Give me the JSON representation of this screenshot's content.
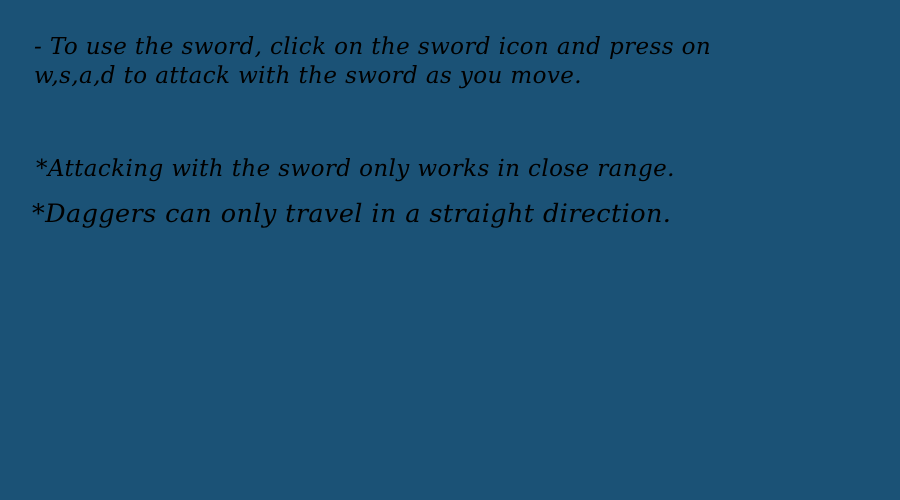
{
  "instructions": {
    "sword_line_1": "- To use the sword, click on the sword icon and press on",
    "sword_line_2": "w,s,a,d to attack with the sword as you move.",
    "sword_range_note": "*Attacking with the sword only works in close range.",
    "dagger_note": "*Daggers can only travel in a straight direction."
  },
  "colors": {
    "background": "#1b5276",
    "text": "#000000"
  }
}
